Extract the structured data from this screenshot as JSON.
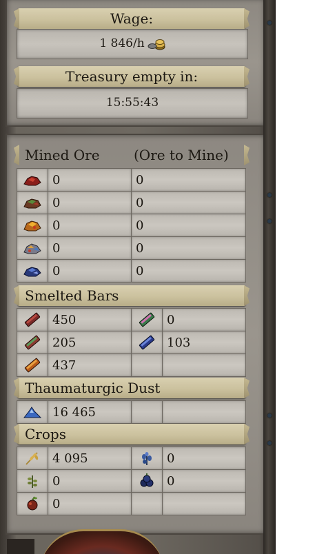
{
  "wage": {
    "label": "Wage:",
    "value": "1 846/h"
  },
  "treasury": {
    "label": "Treasury empty in:",
    "value": "15:55:43"
  },
  "mined_ore": {
    "header_left": "Mined Ore",
    "header_right": "(Ore to Mine)",
    "rows": [
      {
        "icon": "red-ore-icon",
        "mined": "0",
        "to_mine": "0"
      },
      {
        "icon": "green-red-ore-icon",
        "mined": "0",
        "to_mine": "0"
      },
      {
        "icon": "gold-ore-icon",
        "mined": "0",
        "to_mine": "0"
      },
      {
        "icon": "mixed-ore-icon",
        "mined": "0",
        "to_mine": "0"
      },
      {
        "icon": "blue-ore-icon",
        "mined": "0",
        "to_mine": "0"
      }
    ]
  },
  "smelted_bars": {
    "header": "Smelted Bars",
    "rows": [
      {
        "left_icon": "red-bar-icon",
        "left_value": "450",
        "right_icon": "green-pink-bar-icon",
        "right_value": "0"
      },
      {
        "left_icon": "red-green-bar-icon",
        "left_value": "205",
        "right_icon": "blue-bar-icon",
        "right_value": "103"
      },
      {
        "left_icon": "orange-bar-icon",
        "left_value": "437",
        "right_icon": "",
        "right_value": ""
      }
    ]
  },
  "thaumaturgic_dust": {
    "header": "Thaumaturgic Dust",
    "icon": "blue-dust-icon",
    "value": "16 465"
  },
  "crops": {
    "header": "Crops",
    "rows": [
      {
        "left_icon": "wheat-icon",
        "left_value": "4 095",
        "right_icon": "blue-herb-icon",
        "right_value": "0"
      },
      {
        "left_icon": "green-herb-icon",
        "left_value": "0",
        "right_icon": "dark-berry-icon",
        "right_value": "0"
      },
      {
        "left_icon": "red-fruit-icon",
        "left_value": "0",
        "right_icon": "",
        "right_value": ""
      }
    ]
  }
}
